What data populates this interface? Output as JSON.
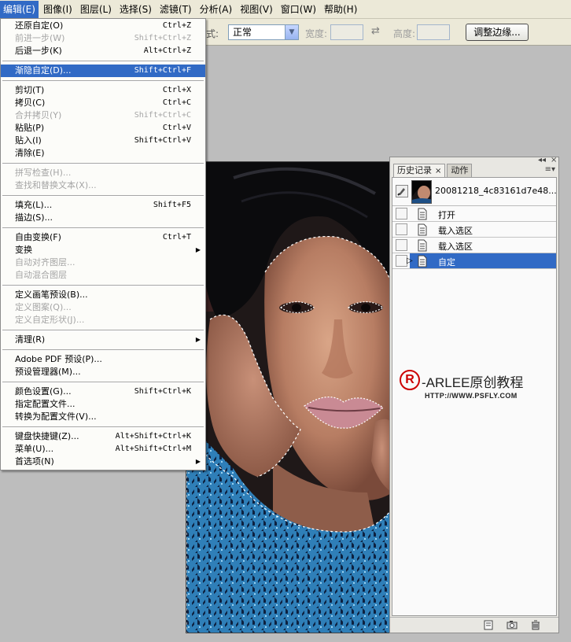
{
  "menubar": {
    "items": [
      {
        "label": "编辑(E)"
      },
      {
        "label": "图像(I)"
      },
      {
        "label": "图层(L)"
      },
      {
        "label": "选择(S)"
      },
      {
        "label": "滤镜(T)"
      },
      {
        "label": "分析(A)"
      },
      {
        "label": "视图(V)"
      },
      {
        "label": "窗口(W)"
      },
      {
        "label": "帮助(H)"
      }
    ]
  },
  "options": {
    "style_suffix": "式:",
    "style_value": "正常",
    "width_label": "宽度:",
    "height_label": "高度:",
    "refine_edge_label": "调整边缘..."
  },
  "edit_menu": {
    "items": [
      {
        "label": "还原自定(O)",
        "shortcut": "Ctrl+Z"
      },
      {
        "label": "前进一步(W)",
        "shortcut": "Shift+Ctrl+Z"
      },
      {
        "label": "后退一步(K)",
        "shortcut": "Alt+Ctrl+Z"
      },
      {
        "label": "渐隐自定(D)...",
        "shortcut": "Shift+Ctrl+F"
      },
      {
        "label": "剪切(T)",
        "shortcut": "Ctrl+X"
      },
      {
        "label": "拷贝(C)",
        "shortcut": "Ctrl+C"
      },
      {
        "label": "合并拷贝(Y)",
        "shortcut": "Shift+Ctrl+C"
      },
      {
        "label": "粘贴(P)",
        "shortcut": "Ctrl+V"
      },
      {
        "label": "贴入(I)",
        "shortcut": "Shift+Ctrl+V"
      },
      {
        "label": "清除(E)",
        "shortcut": ""
      },
      {
        "label": "拼写检查(H)...",
        "shortcut": ""
      },
      {
        "label": "查找和替换文本(X)...",
        "shortcut": ""
      },
      {
        "label": "填充(L)...",
        "shortcut": "Shift+F5"
      },
      {
        "label": "描边(S)...",
        "shortcut": ""
      },
      {
        "label": "自由变换(F)",
        "shortcut": "Ctrl+T"
      },
      {
        "label": "变换",
        "shortcut": ""
      },
      {
        "label": "自动对齐图层...",
        "shortcut": ""
      },
      {
        "label": "自动混合图层",
        "shortcut": ""
      },
      {
        "label": "定义画笔预设(B)...",
        "shortcut": ""
      },
      {
        "label": "定义图案(Q)...",
        "shortcut": ""
      },
      {
        "label": "定义自定形状(J)...",
        "shortcut": ""
      },
      {
        "label": "清理(R)",
        "shortcut": ""
      },
      {
        "label": "Adobe PDF 预设(P)...",
        "shortcut": ""
      },
      {
        "label": "预设管理器(M)...",
        "shortcut": ""
      },
      {
        "label": "颜色设置(G)...",
        "shortcut": "Shift+Ctrl+K"
      },
      {
        "label": "指定配置文件...",
        "shortcut": ""
      },
      {
        "label": "转换为配置文件(V)...",
        "shortcut": ""
      },
      {
        "label": "键盘快捷键(Z)...",
        "shortcut": "Alt+Shift+Ctrl+K"
      },
      {
        "label": "菜单(U)...",
        "shortcut": "Alt+Shift+Ctrl+M"
      },
      {
        "label": "首选项(N)",
        "shortcut": ""
      }
    ]
  },
  "history_panel": {
    "tab_history": "历史记录",
    "tab_actions": "动作",
    "snapshot_name": "20081218_4c83161d7e48...",
    "states": [
      {
        "label": "打开"
      },
      {
        "label": "载入选区"
      },
      {
        "label": "载入选区"
      },
      {
        "label": "自定"
      }
    ]
  },
  "watermark": {
    "mark": "R",
    "text": "-ARLEE原创教程",
    "url": "HTTP://WWW.PSFLY.COM"
  },
  "colors": {
    "menu_bg": "#ece9d8",
    "highlight": "#316ac5",
    "disabled_text": "#a5a5a5",
    "workspace_bg": "#bdbdbd",
    "watermark_red": "#cc0000"
  }
}
